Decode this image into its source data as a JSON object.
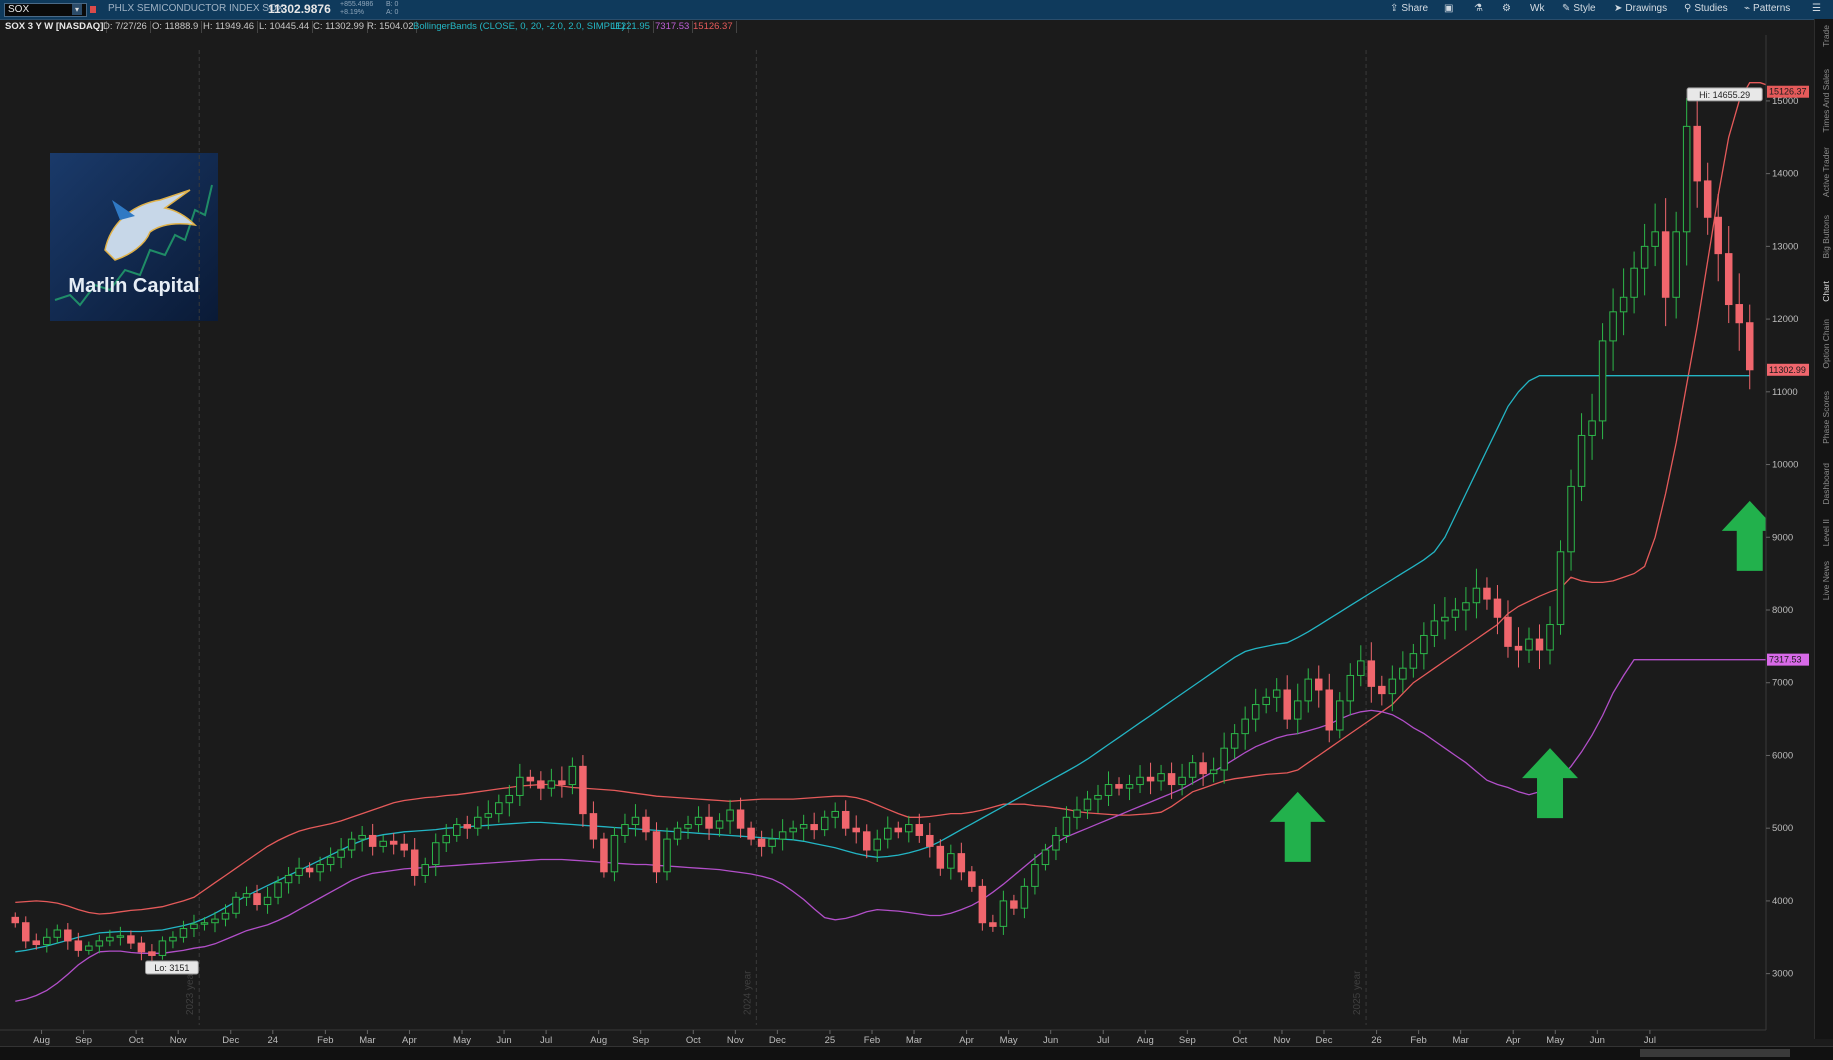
{
  "toolbar": {
    "symbol": "SOX",
    "description": "PHLX SEMICONDUCTOR INDEX SOX",
    "last_price": "11302.9876",
    "change_abs": "+855.4986",
    "change_pct": "+8.19%",
    "bid": "B: 0",
    "ask": "A: 0",
    "share_label": "Share",
    "timeframe_label": "Wk",
    "style_label": "Style",
    "drawings_label": "Drawings",
    "studies_label": "Studies",
    "patterns_label": "Patterns"
  },
  "infobar": {
    "title": "SOX 3 Y W [NASDAQ]",
    "date": "D: 7/27/26",
    "open": "O: 11888.9",
    "high": "H: 11949.46",
    "low": "L: 10445.44",
    "close": "C: 11302.99",
    "range": "R: 1504.02",
    "study": "BollingerBands (CLOSE, 0, 20, -2.0, 2.0, SIMPLE)",
    "mid": "11221.95",
    "lower": "7317.53",
    "upper": "15126.37"
  },
  "logo": {
    "text": "Marlin Capital"
  },
  "right_tabs": [
    "Trade",
    "Times And Sales",
    "Active Trader",
    "Big Buttons",
    "Chart",
    "Option Chain",
    "Phase Scores",
    "Dashboard",
    "Level II",
    "Live News"
  ],
  "colors": {
    "up": "#2db84a",
    "down": "#f0666d",
    "upper_band": "#e55a5a",
    "middle_band": "#23b5c4",
    "lower_band": "#b24fc9",
    "arrow": "#22b14c"
  },
  "chart_data": {
    "type": "candlestick",
    "title": "SOX 3 Y W [NASDAQ]",
    "interval": "weekly",
    "ylim": [
      2500,
      15700
    ],
    "y_ticks": [
      3000,
      4000,
      5000,
      6000,
      7000,
      8000,
      9000,
      10000,
      11000,
      12000,
      13000,
      14000,
      15000
    ],
    "x_ticks": [
      "Aug",
      "Sep",
      "Oct",
      "Nov",
      "Dec",
      "24",
      "Feb",
      "Mar",
      "Apr",
      "May",
      "Jun",
      "Jul",
      "Aug",
      "Sep",
      "Oct",
      "Nov",
      "Dec",
      "25",
      "Feb",
      "Mar",
      "Apr",
      "May",
      "Jun",
      "Jul",
      "Aug",
      "Sep",
      "Oct",
      "Nov",
      "Dec",
      "26",
      "Feb",
      "Mar",
      "Apr",
      "May",
      "Jun",
      "Jul"
    ],
    "year_markers": [
      "2023 year",
      "2024 year",
      "2025 year"
    ],
    "closes": [
      3700,
      3450,
      3400,
      3500,
      3600,
      3450,
      3320,
      3380,
      3450,
      3500,
      3520,
      3420,
      3300,
      3250,
      3450,
      3500,
      3620,
      3680,
      3700,
      3750,
      3830,
      4050,
      4100,
      3950,
      4050,
      4250,
      4350,
      4450,
      4400,
      4500,
      4600,
      4700,
      4850,
      4900,
      4750,
      4820,
      4780,
      4700,
      4350,
      4500,
      4800,
      4900,
      5050,
      5000,
      5150,
      5200,
      5350,
      5450,
      5700,
      5650,
      5550,
      5650,
      5600,
      5850,
      5200,
      4850,
      4400,
      4900,
      5050,
      5150,
      4950,
      4400,
      4850,
      5000,
      5050,
      5150,
      5000,
      5100,
      5250,
      5000,
      4850,
      4750,
      4850,
      4950,
      5000,
      5050,
      4980,
      5150,
      5230,
      5000,
      4950,
      4700,
      4850,
      5000,
      4950,
      5050,
      4900,
      4750,
      4450,
      4650,
      4400,
      4200,
      3700,
      3650,
      4000,
      3900,
      4200,
      4500,
      4700,
      4900,
      5150,
      5250,
      5400,
      5450,
      5600,
      5550,
      5600,
      5700,
      5650,
      5750,
      5600,
      5700,
      5900,
      5750,
      5800,
      6100,
      6300,
      6500,
      6700,
      6800,
      6900,
      6500,
      6750,
      7050,
      6900,
      6350,
      6750,
      7100,
      7300,
      6950,
      6850,
      7050,
      7200,
      7400,
      7650,
      7850,
      7900,
      8000,
      8100,
      8300,
      8150,
      7900,
      7500,
      7450,
      7600,
      7450,
      7800,
      8800,
      9700,
      10400,
      10600,
      11700,
      12100,
      12300,
      12700,
      13000,
      13200,
      12300,
      13200,
      14650,
      13900,
      13400,
      12900,
      12200,
      11950,
      11303
    ],
    "upper_band": [
      3980,
      3990,
      4000,
      3990,
      3970,
      3930,
      3880,
      3840,
      3820,
      3830,
      3850,
      3870,
      3880,
      3900,
      3920,
      3960,
      4000,
      4050,
      4150,
      4250,
      4350,
      4450,
      4550,
      4650,
      4750,
      4830,
      4900,
      4960,
      5000,
      5030,
      5060,
      5100,
      5150,
      5200,
      5250,
      5300,
      5350,
      5380,
      5400,
      5420,
      5430,
      5450,
      5460,
      5480,
      5500,
      5520,
      5540,
      5560,
      5580,
      5590,
      5600,
      5600,
      5580,
      5560,
      5550,
      5540,
      5530,
      5520,
      5500,
      5480,
      5460,
      5440,
      5430,
      5420,
      5410,
      5400,
      5390,
      5380,
      5370,
      5380,
      5390,
      5400,
      5400,
      5400,
      5400,
      5410,
      5420,
      5430,
      5440,
      5440,
      5420,
      5380,
      5320,
      5260,
      5200,
      5150,
      5150,
      5160,
      5180,
      5200,
      5200,
      5220,
      5250,
      5290,
      5330,
      5330,
      5330,
      5310,
      5300,
      5280,
      5260,
      5230,
      5210,
      5200,
      5190,
      5180,
      5180,
      5190,
      5200,
      5220,
      5300,
      5400,
      5500,
      5550,
      5600,
      5650,
      5680,
      5700,
      5720,
      5740,
      5750,
      5760,
      5800,
      5900,
      6000,
      6100,
      6200,
      6300,
      6400,
      6500,
      6600,
      6700,
      6850,
      7000,
      7100,
      7200,
      7300,
      7400,
      7500,
      7600,
      7700,
      7800,
      7950,
      8050,
      8120,
      8190,
      8250,
      8300,
      8450,
      8400,
      8380,
      8380,
      8400,
      8450,
      8500,
      8600,
      9000,
      9600,
      10300,
      11100,
      11900,
      12800,
      13700,
      14500,
      15000,
      15250,
      15250,
      15200,
      15150,
      15126
    ],
    "middle_band": [
      3300,
      3320,
      3350,
      3380,
      3420,
      3460,
      3500,
      3530,
      3560,
      3570,
      3580,
      3580,
      3580,
      3590,
      3600,
      3630,
      3660,
      3700,
      3760,
      3830,
      3910,
      3990,
      4070,
      4140,
      4210,
      4280,
      4350,
      4420,
      4490,
      4560,
      4630,
      4700,
      4770,
      4830,
      4880,
      4910,
      4930,
      4950,
      4960,
      4970,
      4980,
      5000,
      5010,
      5020,
      5030,
      5040,
      5050,
      5060,
      5070,
      5080,
      5080,
      5070,
      5060,
      5050,
      5040,
      5030,
      5020,
      5010,
      5000,
      4990,
      4980,
      4970,
      4960,
      4950,
      4940,
      4930,
      4920,
      4910,
      4900,
      4890,
      4880,
      4870,
      4860,
      4850,
      4840,
      4820,
      4790,
      4760,
      4730,
      4690,
      4650,
      4620,
      4600,
      4610,
      4630,
      4660,
      4700,
      4750,
      4820,
      4900,
      4980,
      5060,
      5140,
      5220,
      5300,
      5380,
      5460,
      5540,
      5620,
      5700,
      5780,
      5860,
      5950,
      6050,
      6150,
      6250,
      6350,
      6450,
      6550,
      6650,
      6750,
      6850,
      6950,
      7050,
      7150,
      7250,
      7350,
      7430,
      7470,
      7500,
      7530,
      7550,
      7620,
      7700,
      7790,
      7880,
      7970,
      8060,
      8150,
      8240,
      8330,
      8420,
      8510,
      8600,
      8690,
      8800,
      9000,
      9300,
      9600,
      9900,
      10200,
      10500,
      10800,
      11000,
      11150,
      11222,
      11222,
      11222,
      11222,
      11222,
      11222,
      11222,
      11222,
      11222,
      11222,
      11222,
      11222,
      11222,
      11222,
      11222,
      11222,
      11222,
      11222,
      11222,
      11222,
      11222
    ],
    "lower_band": [
      2620,
      2650,
      2700,
      2770,
      2870,
      2990,
      3120,
      3220,
      3300,
      3310,
      3310,
      3290,
      3280,
      3280,
      3280,
      3300,
      3320,
      3350,
      3370,
      3410,
      3470,
      3530,
      3590,
      3630,
      3670,
      3730,
      3800,
      3880,
      3960,
      4040,
      4120,
      4200,
      4280,
      4340,
      4380,
      4400,
      4420,
      4440,
      4450,
      4460,
      4470,
      4480,
      4490,
      4500,
      4510,
      4520,
      4530,
      4540,
      4550,
      4560,
      4570,
      4570,
      4570,
      4560,
      4550,
      4540,
      4530,
      4520,
      4510,
      4500,
      4500,
      4490,
      4480,
      4470,
      4460,
      4450,
      4440,
      4430,
      4410,
      4390,
      4370,
      4340,
      4300,
      4230,
      4130,
      4020,
      3890,
      3770,
      3740,
      3760,
      3800,
      3850,
      3880,
      3870,
      3860,
      3840,
      3820,
      3800,
      3800,
      3830,
      3880,
      3940,
      4020,
      4120,
      4230,
      4350,
      4470,
      4590,
      4700,
      4800,
      4880,
      4940,
      5000,
      5060,
      5120,
      5180,
      5240,
      5300,
      5360,
      5420,
      5480,
      5540,
      5620,
      5700,
      5780,
      5860,
      5950,
      6040,
      6120,
      6180,
      6240,
      6280,
      6300,
      6340,
      6380,
      6430,
      6500,
      6560,
      6600,
      6620,
      6600,
      6560,
      6480,
      6380,
      6300,
      6200,
      6100,
      6000,
      5900,
      5780,
      5660,
      5600,
      5560,
      5500,
      5460,
      5500,
      5580,
      5700,
      5850,
      6050,
      6280,
      6550,
      6860,
      7100,
      7317,
      7317,
      7317,
      7317,
      7317,
      7317,
      7317,
      7317,
      7317,
      7317,
      7317,
      7317,
      7317,
      7317,
      7317,
      7317
    ],
    "annotations": {
      "high_label": "Hi: 14655.29",
      "low_label": "Lo: 3151",
      "last_price": "11302.99",
      "upper_band_value": "15126.37",
      "lower_band_value": "7317.53"
    },
    "arrows": [
      {
        "type": "up",
        "y": 5500
      },
      {
        "type": "up",
        "y": 6100
      },
      {
        "type": "up",
        "y": 9500
      }
    ]
  }
}
